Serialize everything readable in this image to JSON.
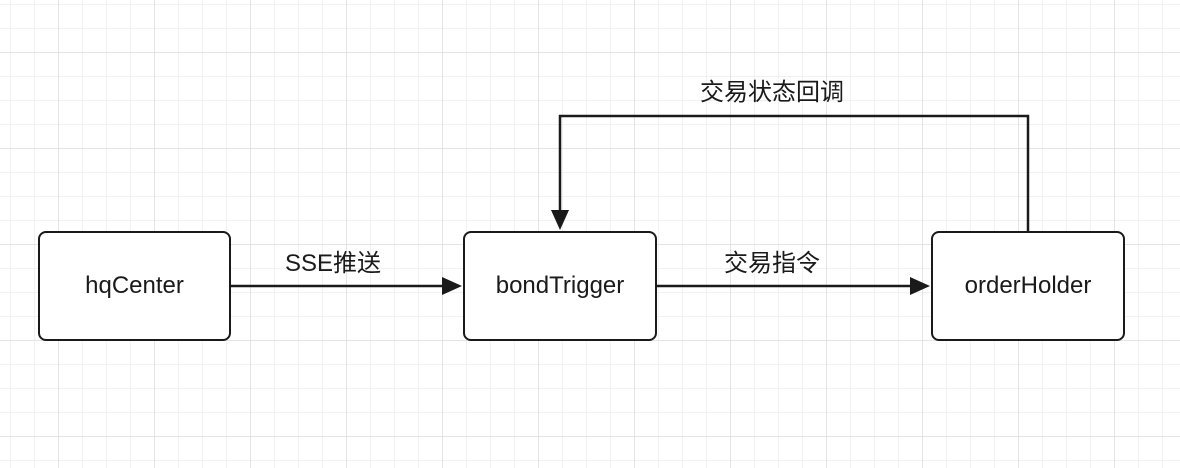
{
  "diagram": {
    "nodes": {
      "hqcenter": "hqCenter",
      "bondtrigger": "bondTrigger",
      "orderholder": "orderHolder"
    },
    "edges": {
      "sse_push": "SSE推送",
      "trade_command": "交易指令",
      "trade_status_callback": "交易状态回调"
    },
    "colors": {
      "stroke": "#1a1a1a",
      "node_fill": "#ffffff",
      "grid_major": "#e4e4e4",
      "grid_minor": "#f1f1f1"
    }
  }
}
